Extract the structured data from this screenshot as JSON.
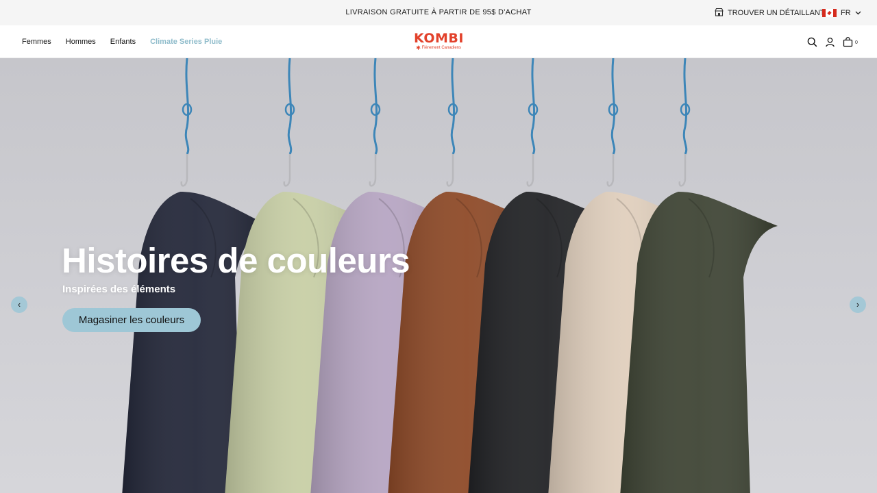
{
  "announcement": {
    "text": "LIVRAISON GRATUITE À PARTIR DE 95$ D'ACHAT",
    "retailer_label": "TROUVER UN DÉTAILLANT",
    "language": "FR"
  },
  "header": {
    "nav": [
      {
        "label": "Femmes"
      },
      {
        "label": "Hommes"
      },
      {
        "label": "Enfants"
      },
      {
        "label": "Climate Series Pluie"
      }
    ],
    "logo": {
      "wordmark": "KOMBI",
      "tagline": "Fièrement Canadiens"
    },
    "cart_count": "0"
  },
  "hero": {
    "title": "Histoires de couleurs",
    "subtitle": "Inspirées des éléments",
    "cta": "Magasiner les couleurs",
    "prev_arrow": "‹",
    "next_arrow": "›"
  },
  "colors": {
    "brand_red": "#e2412b",
    "accent_blue": "#9ec7d6",
    "nav_accent": "#8fbccb",
    "jacket_colors": [
      "#24283a",
      "#c8cfa6",
      "#b7a6c3",
      "#8e4a28",
      "#222326",
      "#e0cfbd",
      "#3f4535"
    ]
  },
  "icons": [
    "store-icon",
    "canada-flag-icon",
    "chevron-down-icon",
    "search-icon",
    "account-icon",
    "cart-icon",
    "chevron-left-icon",
    "chevron-right-icon"
  ]
}
